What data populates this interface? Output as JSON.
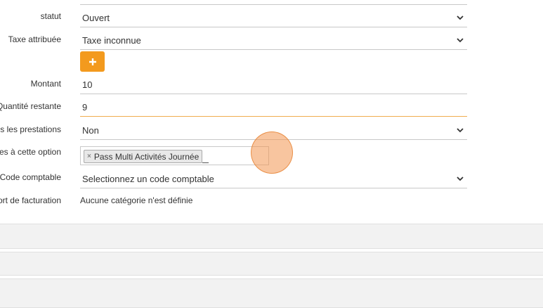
{
  "form": {
    "statut": {
      "label": "statut",
      "value": "Ouvert"
    },
    "taxe": {
      "label": "Taxe attribuée",
      "value": "Taxe inconnue"
    },
    "add_button_symbol": "+",
    "montant": {
      "label": "Montant",
      "value": "10"
    },
    "quantite": {
      "label": "Quantité restante",
      "value": "9"
    },
    "prestations": {
      "label": "es les prestations",
      "value": "Non"
    },
    "option": {
      "label": "es à cette option",
      "tag": "Pass Multi Activités Journée",
      "tag_remove": "×"
    },
    "code_comptable": {
      "label": "Code comptable",
      "value": "Selectionnez un code comptable"
    },
    "facturation": {
      "label": "ort de facturation",
      "value": "Aucune catégorie n'est définie"
    }
  },
  "colors": {
    "accent": "#f39a1e",
    "focus_border": "#f0ad4e",
    "panel_bg": "#f2f2f2"
  },
  "icons": [
    "chevron-down-icon",
    "plus-icon",
    "remove-icon"
  ]
}
